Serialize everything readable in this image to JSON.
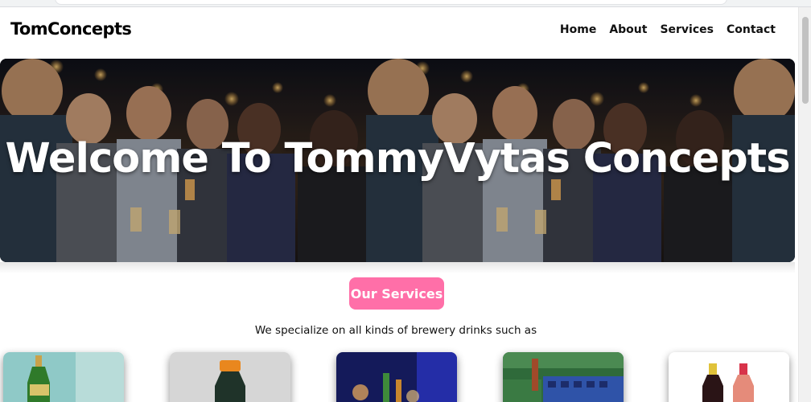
{
  "header": {
    "brand": "TomConcepts",
    "nav": [
      "Home",
      "About",
      "Services",
      "Contact"
    ]
  },
  "hero": {
    "title": "Welcome To TommyVytas Concepts"
  },
  "services": {
    "button_label": "Our Services",
    "description": "We specialize on all kinds of brewery drinks such as"
  },
  "colors": {
    "accent": "#ff6fa8",
    "hero_overlay": "#1a1a22",
    "text": "#111111"
  },
  "cards": [
    {
      "icon": "green-beer-bottle-icon"
    },
    {
      "icon": "dark-bottle-orange-cap-icon"
    },
    {
      "icon": "bar-beer-bottle-icon"
    },
    {
      "icon": "beer-crate-icon"
    },
    {
      "icon": "wine-bottles-icon"
    }
  ]
}
